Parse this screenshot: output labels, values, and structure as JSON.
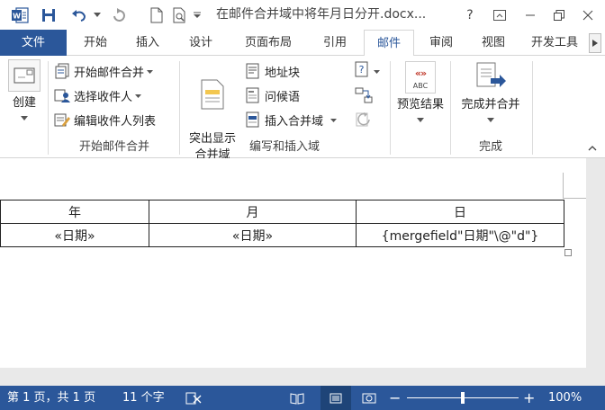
{
  "titlebar": {
    "title": "在邮件合并域中将年月日分开.docx...",
    "help_label": "?",
    "app_icon": "word-logo-icon",
    "colors": {
      "brand": "#2b579a"
    }
  },
  "tabs": [
    {
      "label": "文件"
    },
    {
      "label": "开始"
    },
    {
      "label": "插入"
    },
    {
      "label": "设计"
    },
    {
      "label": "页面布局"
    },
    {
      "label": "引用"
    },
    {
      "label": "邮件"
    },
    {
      "label": "审阅"
    },
    {
      "label": "视图"
    },
    {
      "label": "开发工具"
    }
  ],
  "ribbon": {
    "create_label": "创建",
    "start_merge": "开始邮件合并",
    "select_recipients": "选择收件人",
    "edit_recipients": "编辑收件人列表",
    "group_start": "开始邮件合并",
    "highlight_fields": "突出显示\n合并域",
    "address_block": "地址块",
    "greeting_line": "问候语",
    "insert_merge_field": "插入合并域",
    "group_write": "编写和插入域",
    "preview_results": "预览结果",
    "preview_icon_text": "ABC",
    "finish_merge": "完成并合并",
    "group_finish": "完成"
  },
  "document": {
    "table": {
      "headers": [
        "年",
        "月",
        "日"
      ],
      "row": [
        "«日期»",
        "«日期»",
        "{mergefield\"日期\"\\@\"d\"}"
      ]
    }
  },
  "status": {
    "page": "第 1 页，共 1 页",
    "words": "11 个字",
    "zoom": "100%",
    "zoom_level": 1.0
  }
}
